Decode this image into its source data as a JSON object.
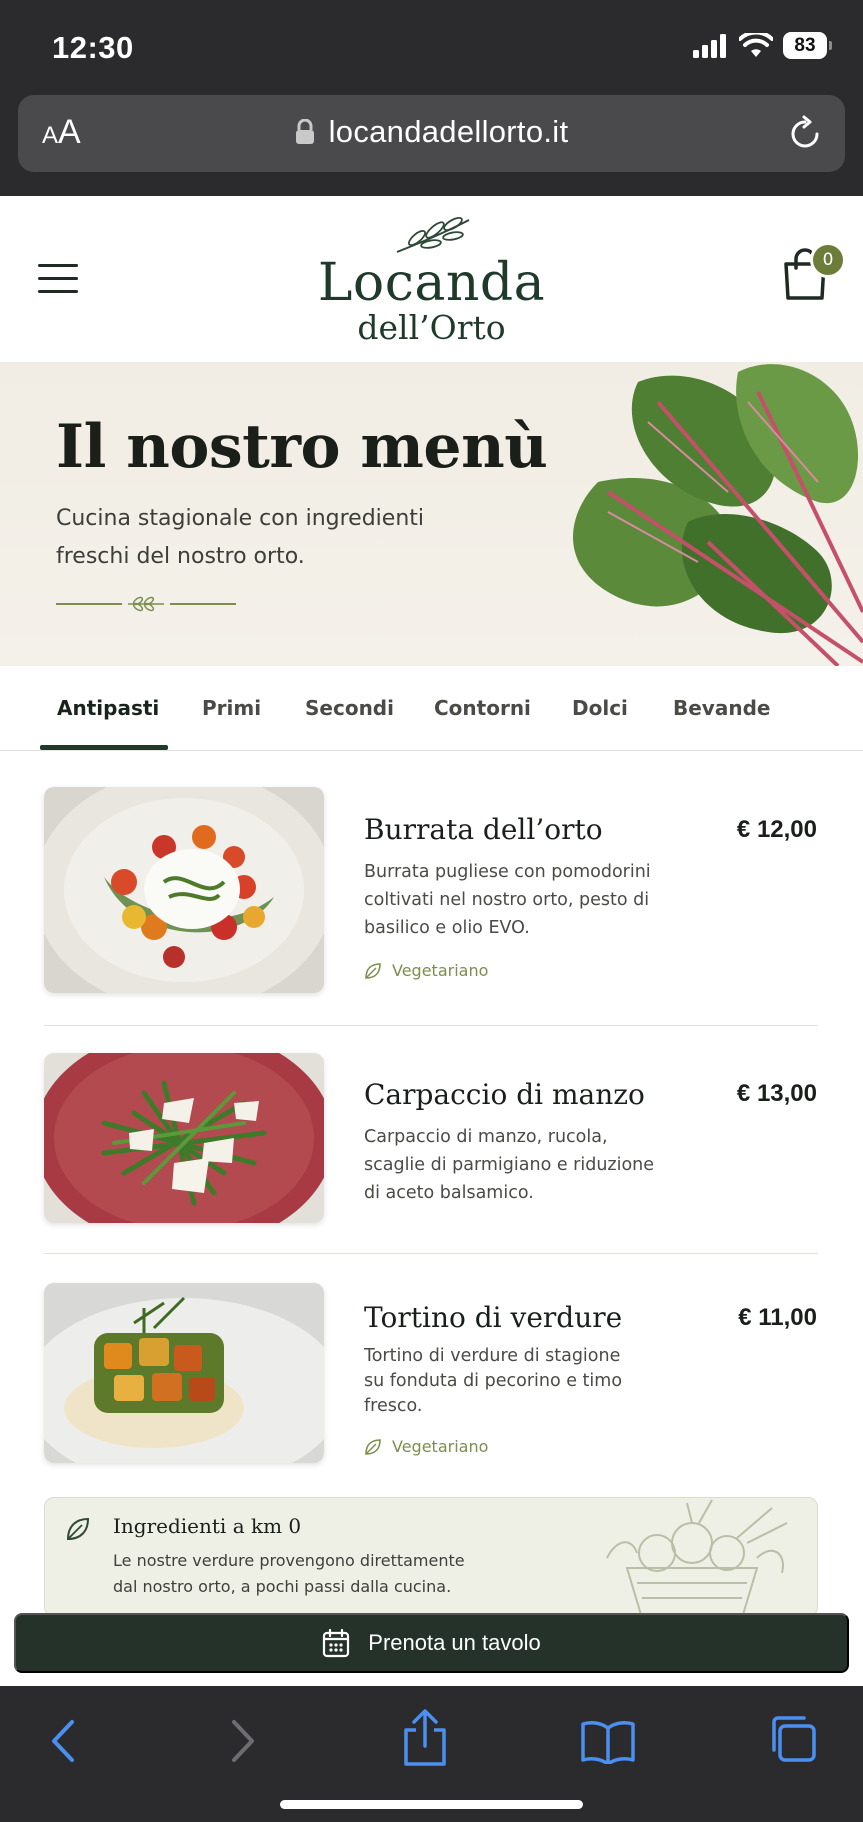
{
  "status_bar": {
    "time": "12:30",
    "battery": "83"
  },
  "browser": {
    "text_size_label_small": "A",
    "text_size_label_large": "A",
    "url": "locandadellorto.it"
  },
  "header": {
    "logo_title": "Locanda",
    "logo_subtitle": "dell’Orto",
    "cart_count": "0"
  },
  "hero": {
    "title": "Il nostro menù",
    "subtitle": "Cucina stagionale con ingredienti freschi del nostro orto."
  },
  "tabs": [
    {
      "label": "Antipasti",
      "active": true
    },
    {
      "label": "Primi"
    },
    {
      "label": "Secondi"
    },
    {
      "label": "Contorni"
    },
    {
      "label": "Dolci"
    },
    {
      "label": "Bevande"
    }
  ],
  "menu_items": [
    {
      "name": "Burrata dell’orto",
      "price": "€ 12,00",
      "description": "Burrata pugliese con pomodorini coltivati nel nostro orto, pesto di basilico e olio EVO.",
      "tag": "Vegetariano"
    },
    {
      "name": "Carpaccio di manzo",
      "price": "€ 13,00",
      "description": "Carpaccio di manzo, rucola, scaglie di parmigiano e riduzione di aceto balsamico."
    },
    {
      "name": "Tortino di verdure",
      "price": "€ 11,00",
      "description": "Tortino di verdure di stagione su fonduta di pecorino e timo fresco.",
      "tag": "Vegetariano"
    }
  ],
  "info_banner": {
    "title": "Ingredienti a km 0",
    "text": "Le nostre verdure provengono direttamente dal nostro orto, a pochi passi dalla cucina."
  },
  "reserve_button": {
    "label": "Prenota un tavolo"
  },
  "colors": {
    "brand_green": "#1f3a2a",
    "accent_olive": "#6c7d3a",
    "tag_green": "#7d8d4f",
    "button_dark": "#24322a",
    "safari_blue": "#4b8ff0"
  }
}
